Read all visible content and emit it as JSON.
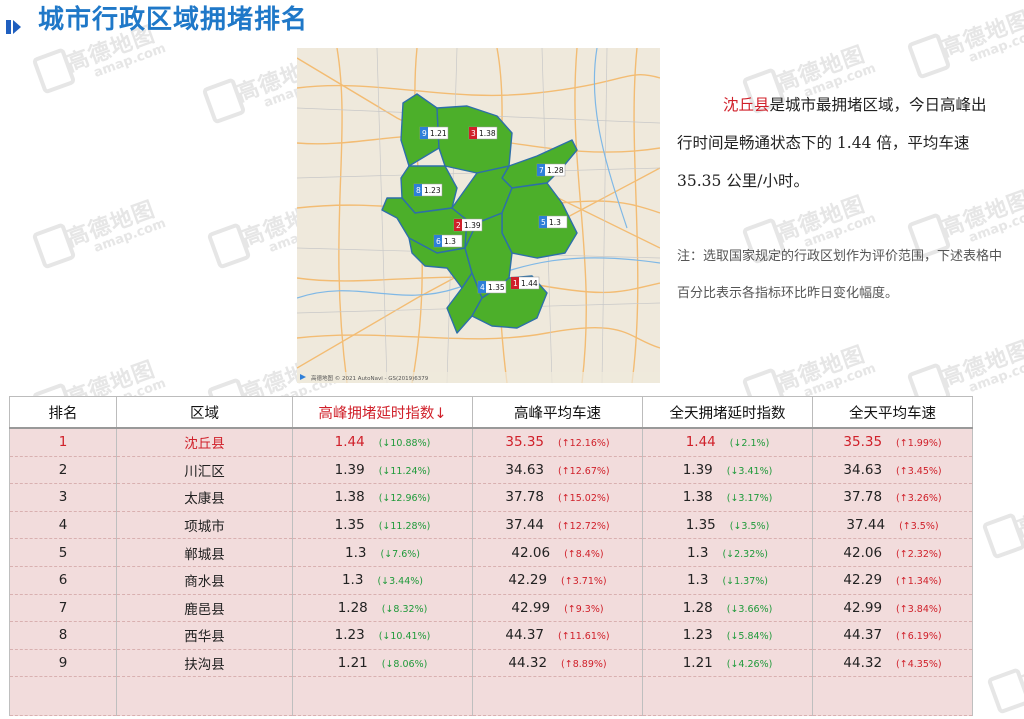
{
  "header": {
    "title": "城市行政区域拥堵排名"
  },
  "map": {
    "attribution": "高德地图 © 2021 AutoNavi - GS(2019)6379",
    "markers": [
      {
        "rank": "9",
        "value": "1.21",
        "color": "#2f7fd8"
      },
      {
        "rank": "3",
        "value": "1.38",
        "color": "#d0202a"
      },
      {
        "rank": "7",
        "value": "1.28",
        "color": "#2f7fd8"
      },
      {
        "rank": "8",
        "value": "1.23",
        "color": "#2f7fd8"
      },
      {
        "rank": "2",
        "value": "1.39",
        "color": "#d0202a"
      },
      {
        "rank": "5",
        "value": "1.3",
        "color": "#2f7fd8"
      },
      {
        "rank": "6",
        "value": "1.3",
        "color": "#2f7fd8"
      },
      {
        "rank": "4",
        "value": "1.35",
        "color": "#2f7fd8"
      },
      {
        "rank": "1",
        "value": "1.44",
        "color": "#d0202a"
      }
    ]
  },
  "summary": {
    "district": "沈丘县",
    "text": "是城市最拥堵区域，今日高峰出行时间是畅通状态下的 1.44 倍，平均车速 35.35 公里/小时。"
  },
  "note": "注：选取国家规定的行政区划作为评价范围，下述表格中百分比表示各指标环比昨日变化幅度。",
  "watermark": {
    "brand": "高德地图",
    "site": "amap.com"
  },
  "table": {
    "headers": [
      "排名",
      "区域",
      "高峰拥堵延时指数↓",
      "高峰平均车速",
      "全天拥堵延时指数",
      "全天平均车速"
    ],
    "rows": [
      [
        "1",
        "沈丘县",
        "1.44",
        "(↓10.88%)",
        "35.35",
        "(↑12.16%)",
        "1.44",
        "(↓2.1%)",
        "35.35",
        "(↑1.99%)"
      ],
      [
        "2",
        "川汇区",
        "1.39",
        "(↓11.24%)",
        "34.63",
        "(↑12.67%)",
        "1.39",
        "(↓3.41%)",
        "34.63",
        "(↑3.45%)"
      ],
      [
        "3",
        "太康县",
        "1.38",
        "(↓12.96%)",
        "37.78",
        "(↑15.02%)",
        "1.38",
        "(↓3.17%)",
        "37.78",
        "(↑3.26%)"
      ],
      [
        "4",
        "项城市",
        "1.35",
        "(↓11.28%)",
        "37.44",
        "(↑12.72%)",
        "1.35",
        "(↓3.5%)",
        "37.44",
        "(↑3.5%)"
      ],
      [
        "5",
        "郸城县",
        "1.3",
        "(↓7.6%)",
        "42.06",
        "(↑8.4%)",
        "1.3",
        "(↓2.32%)",
        "42.06",
        "(↑2.32%)"
      ],
      [
        "6",
        "商水县",
        "1.3",
        "(↓3.44%)",
        "42.29",
        "(↑3.71%)",
        "1.3",
        "(↓1.37%)",
        "42.29",
        "(↑1.34%)"
      ],
      [
        "7",
        "鹿邑县",
        "1.28",
        "(↓8.32%)",
        "42.99",
        "(↑9.3%)",
        "1.28",
        "(↓3.66%)",
        "42.99",
        "(↑3.84%)"
      ],
      [
        "8",
        "西华县",
        "1.23",
        "(↓10.41%)",
        "44.37",
        "(↑11.61%)",
        "1.23",
        "(↓5.84%)",
        "44.37",
        "(↑6.19%)"
      ],
      [
        "9",
        "扶沟县",
        "1.21",
        "(↓8.06%)",
        "44.32",
        "(↑8.89%)",
        "1.21",
        "(↓4.26%)",
        "44.32",
        "(↑4.35%)"
      ]
    ]
  }
}
